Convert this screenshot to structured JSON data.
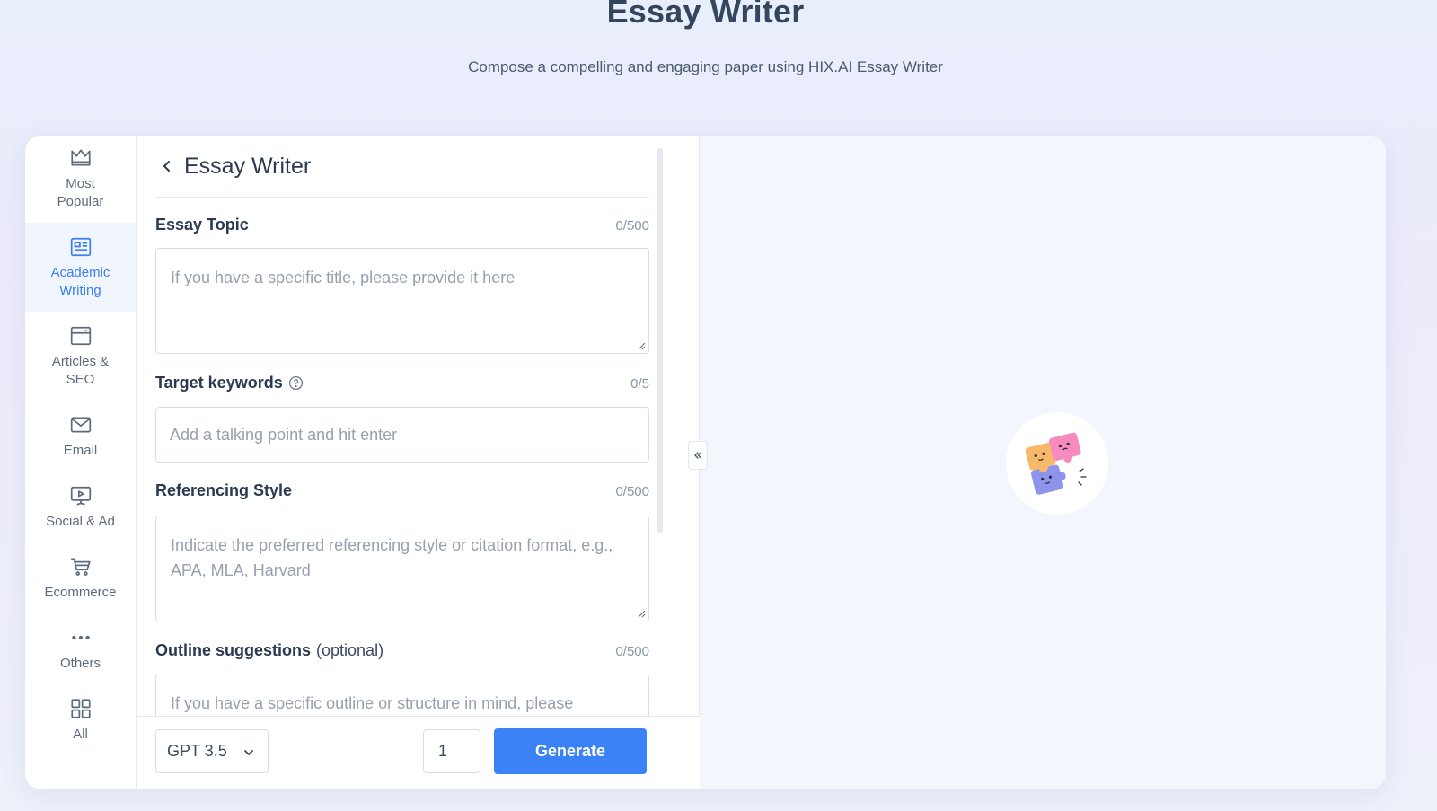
{
  "page": {
    "title": "Essay Writer",
    "subtitle": "Compose a compelling and engaging paper using HIX.AI Essay Writer"
  },
  "sidebar": {
    "items": [
      {
        "label": "Most\nPopular",
        "icon": "crown-icon"
      },
      {
        "label": "Academic\nWriting",
        "icon": "academic-icon",
        "active": true
      },
      {
        "label": "Articles &\nSEO",
        "icon": "articles-icon"
      },
      {
        "label": "Email",
        "icon": "mail-icon"
      },
      {
        "label": "Social & Ad",
        "icon": "presentation-icon"
      },
      {
        "label": "Ecommerce",
        "icon": "cart-icon"
      },
      {
        "label": "Others",
        "icon": "dots-icon"
      },
      {
        "label": "All",
        "icon": "grid-icon"
      }
    ],
    "active_color": "#3b7ff3"
  },
  "form": {
    "title": "Essay Writer",
    "fields": {
      "topic": {
        "label": "Essay Topic",
        "counter": "0/500",
        "placeholder": "If you have a specific title, please provide it here"
      },
      "keywords": {
        "label": "Target keywords",
        "counter": "0/5",
        "placeholder": "Add a talking point and hit enter"
      },
      "referencing": {
        "label": "Referencing Style",
        "counter": "0/500",
        "placeholder": "Indicate the preferred referencing style or citation format, e.g., APA, MLA, Harvard"
      },
      "outline": {
        "label": "Outline suggestions",
        "optional": "(optional)",
        "counter": "0/500",
        "placeholder": "If you have a specific outline or structure in mind, please"
      }
    }
  },
  "footer": {
    "model": "GPT 3.5",
    "quantity": "1",
    "generate_label": "Generate",
    "accent": "#3b82f6"
  }
}
